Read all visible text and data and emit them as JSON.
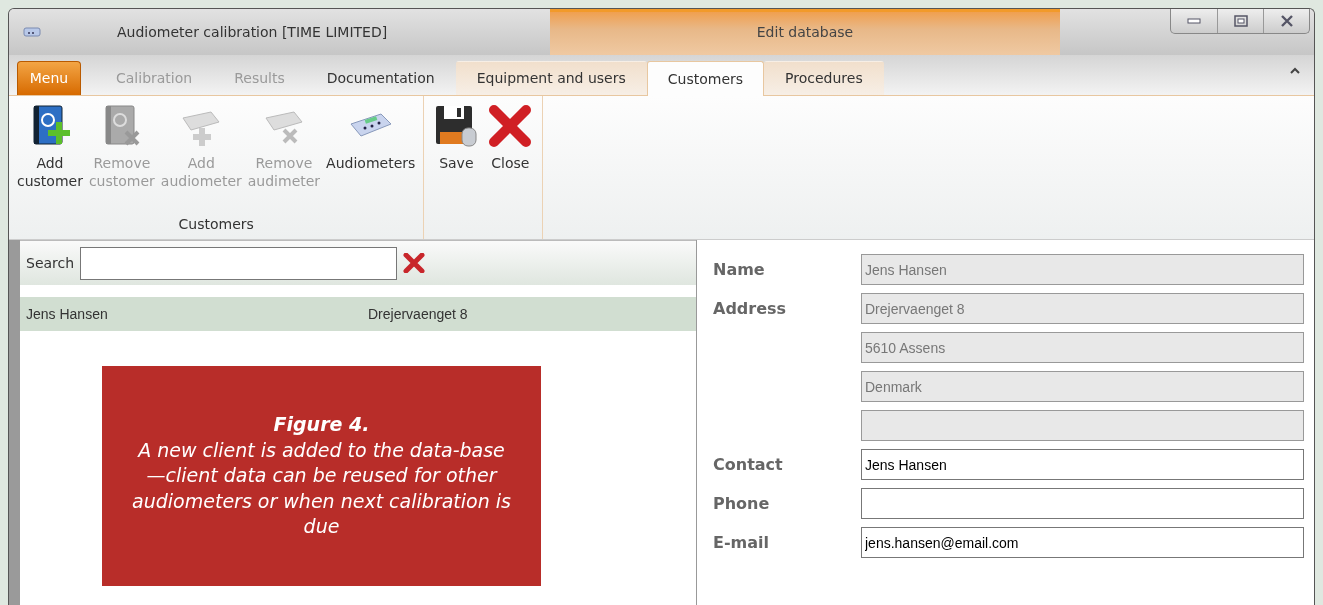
{
  "window": {
    "title": "Audiometer calibration [TIME LIMITED]",
    "contextual_title": "Edit database"
  },
  "menu_button": {
    "label": "Menu"
  },
  "tabs": [
    {
      "label": "Calibration",
      "selected": false,
      "disabled": true,
      "contextual": false
    },
    {
      "label": "Results",
      "selected": false,
      "disabled": true,
      "contextual": false
    },
    {
      "label": "Documentation",
      "selected": false,
      "disabled": false,
      "contextual": false
    },
    {
      "label": "Equipment and users",
      "selected": false,
      "disabled": false,
      "contextual": true
    },
    {
      "label": "Customers",
      "selected": true,
      "disabled": false,
      "contextual": true
    },
    {
      "label": "Procedures",
      "selected": false,
      "disabled": false,
      "contextual": true
    }
  ],
  "ribbon_groups": [
    {
      "label": "Customers",
      "buttons": [
        {
          "kind": "addcustomer",
          "label": "Add customer",
          "disabled": false
        },
        {
          "kind": "removecustomer",
          "label": "Remove customer",
          "disabled": true
        },
        {
          "kind": "addaudiometer",
          "label": "Add audiometer",
          "disabled": true
        },
        {
          "kind": "removeaudiometer",
          "label": "Remove audimeter",
          "disabled": true
        },
        {
          "kind": "audiometers",
          "label": "Audiometers",
          "disabled": false
        }
      ]
    },
    {
      "buttons": [
        {
          "kind": "save",
          "label": "Save",
          "disabled": false
        },
        {
          "kind": "close",
          "label": "Close",
          "disabled": false
        }
      ]
    }
  ],
  "search": {
    "label": "Search"
  },
  "customers": [
    {
      "name": "Jens Hansen",
      "address": "Drejervaenget 8",
      "selected": true
    }
  ],
  "caption": {
    "title": "Figure 4.",
    "text": "A new client is added to the data-base—client data can be reused for other audiometers or when next calibration is due"
  },
  "form": [
    {
      "label": "Name",
      "value": "Jens Hansen",
      "disabled": true
    },
    {
      "label": "Address",
      "value": "Drejervaenget 8",
      "disabled": true
    },
    {
      "value": "5610 Assens",
      "disabled": true
    },
    {
      "value": "Denmark",
      "disabled": true
    },
    {
      "disabled": true
    },
    {
      "label": "Contact",
      "value": "Jens Hansen",
      "disabled": false
    },
    {
      "label": "Phone",
      "disabled": false
    },
    {
      "label": "E-mail",
      "value": "jens.hansen@email.com",
      "disabled": false
    }
  ]
}
